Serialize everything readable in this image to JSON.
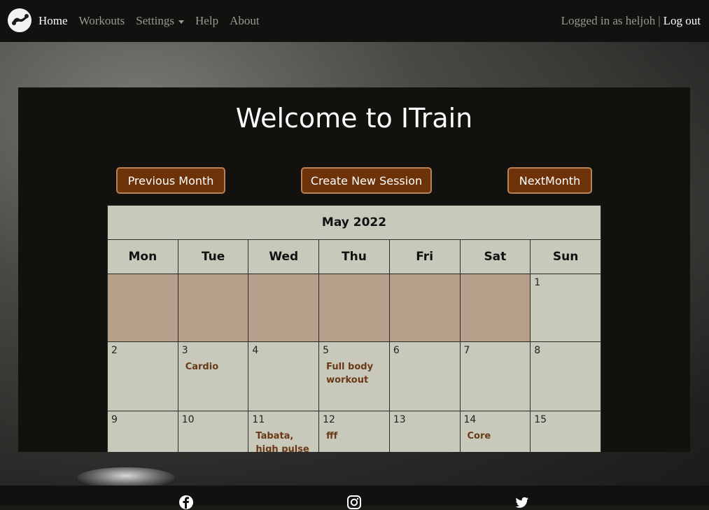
{
  "nav": {
    "links": [
      "Home",
      "Workouts",
      "Settings",
      "Help",
      "About"
    ],
    "logged_in_text": "Logged in as heljoh",
    "separator": "|",
    "logout": "Log out"
  },
  "main": {
    "title": "Welcome to ITrain",
    "prev_button": "Previous Month",
    "create_button": "Create New Session",
    "next_button": "NextMonth"
  },
  "calendar": {
    "month": "May 2022",
    "weekdays": [
      "Mon",
      "Tue",
      "Wed",
      "Thu",
      "Fri",
      "Sat",
      "Sun"
    ],
    "days": {
      "d1": "1",
      "d2": "2",
      "d3": "3",
      "d4": "4",
      "d5": "5",
      "d6": "6",
      "d7": "7",
      "d8": "8",
      "d9": "9",
      "d10": "10",
      "d11": "11",
      "d12": "12",
      "d13": "13",
      "d14": "14",
      "d15": "15"
    },
    "sessions": {
      "d3": "Cardio",
      "d5": "Full body workout",
      "d11": "Tabata, high pulse",
      "d12": "fff",
      "d14": "Core"
    }
  },
  "colors": {
    "nav_bg": "#12110f",
    "button_bg": "#6e3209",
    "button_border": "#b5825a",
    "calendar_bg": "#c8c8bb",
    "empty_cell": "#b6a08b",
    "session_text": "#6a3a16"
  },
  "footer": {
    "icons": [
      "facebook-icon",
      "instagram-icon",
      "twitter-icon"
    ]
  }
}
